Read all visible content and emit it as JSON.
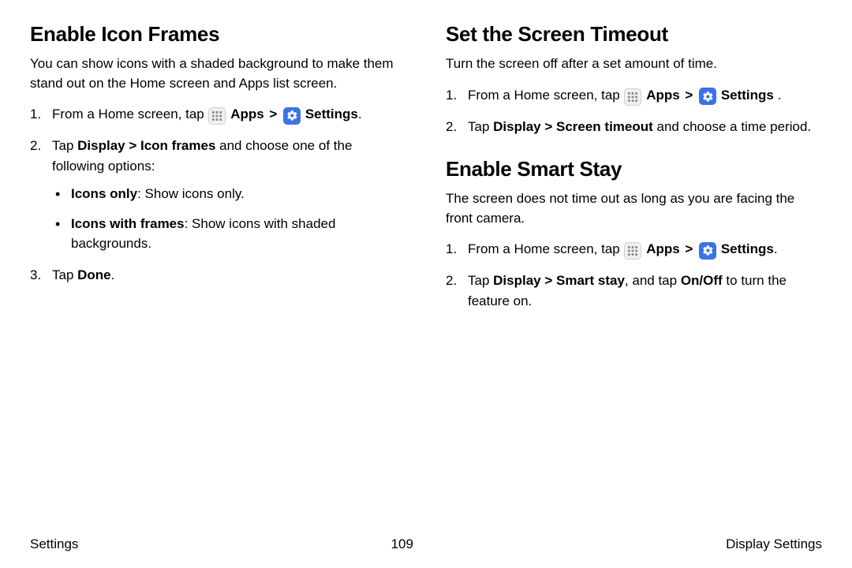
{
  "left": {
    "heading": "Enable Icon Frames",
    "intro": "You can show icons with a shaded background to make them stand out on the Home screen and Apps list screen.",
    "step1_pre": "From a Home screen, tap ",
    "apps_label": "Apps",
    "separator": " > ",
    "settings_label": "Settings",
    "step1_post": ".",
    "step2_pre": "Tap ",
    "step2_bold": "Display > Icon frames",
    "step2_post": " and choose one of the following options:",
    "bullet1_bold": "Icons only",
    "bullet1_post": ": Show icons only.",
    "bullet2_bold": "Icons with frames",
    "bullet2_post": ": Show icons with shaded backgrounds.",
    "step3_pre": "Tap ",
    "step3_bold": "Done",
    "step3_post": "."
  },
  "right": {
    "heading1": "Set the Screen Timeout",
    "intro1": "Turn the screen off after a set amount of time.",
    "r1_step1_pre": "From a Home screen, tap ",
    "apps_label": "Apps",
    "separator": " > ",
    "settings_label": "Settings",
    "r1_step1_post": " .",
    "r1_step2_pre": "Tap ",
    "r1_step2_bold": "Display > Screen timeout",
    "r1_step2_post": " and choose a time period.",
    "heading2": "Enable Smart Stay",
    "intro2": "The screen does not time out as long as you are facing the front camera.",
    "r2_step1_pre": "From a Home screen, tap ",
    "r2_step1_post": ".",
    "r2_step2_pre": "Tap ",
    "r2_step2_bold": "Display > Smart stay",
    "r2_step2_mid": ", and tap ",
    "r2_step2_bold2": "On/Off",
    "r2_step2_post": " to turn the feature on."
  },
  "footer": {
    "left": "Settings",
    "center": "109",
    "right": "Display Settings"
  }
}
